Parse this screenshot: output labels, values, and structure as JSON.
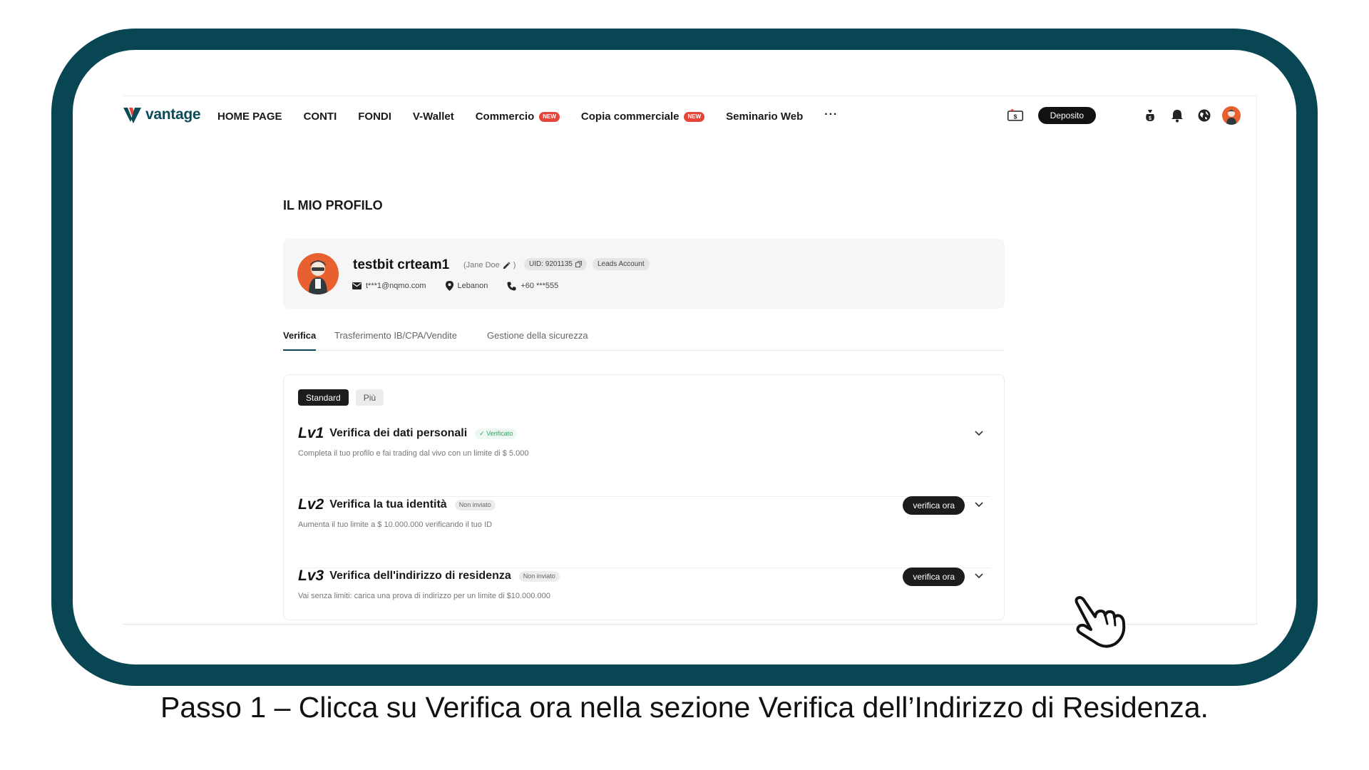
{
  "brand": {
    "name": "vantage"
  },
  "nav": {
    "links": [
      {
        "label": "HOME PAGE"
      },
      {
        "label": "CONTI"
      },
      {
        "label": "FONDI"
      },
      {
        "label": "V-Wallet"
      },
      {
        "label": "Commercio",
        "badge": "NEW"
      },
      {
        "label": "Copia commerciale",
        "badge": "NEW"
      },
      {
        "label": "Seminario Web"
      }
    ],
    "more": "···",
    "deposit_label": "Deposito"
  },
  "page": {
    "title": "IL MIO PROFILO"
  },
  "profile": {
    "name": "testbit crteam1",
    "alias": "(Jane Doe",
    "uid": "UID: 9201135",
    "account_type": "Leads Account",
    "email": "t***1@nqmo.com",
    "location": "Lebanon",
    "phone": "+60 ***555"
  },
  "tabs": [
    {
      "label": "Verifica",
      "active": true
    },
    {
      "label": "Trasferimento IB/CPA/Vendite",
      "active": false
    },
    {
      "label": "Gestione della sicurezza",
      "active": false
    }
  ],
  "verification": {
    "tiers": [
      "Standard",
      "Più"
    ],
    "levels": [
      {
        "tag": "Lv1",
        "title": "Verifica dei dati personali",
        "status": "✓ Verificato",
        "description": "Completa il tuo profilo e fai trading dal vivo con un limite di $ 5.000"
      },
      {
        "tag": "Lv2",
        "title": "Verifica la tua identità",
        "status": "Non inviato",
        "description": "Aumenta il tuo limite a $ 10.000.000 verificando il tuo ID",
        "action": "verifica ora"
      },
      {
        "tag": "Lv3",
        "title": "Verifica dell'indirizzo di residenza",
        "status": "Non inviato",
        "description": "Vai senza limiti: carica una prova di indirizzo per un limite di $10.000.000",
        "action": "verifica ora"
      }
    ]
  },
  "caption": "Passo 1 – Clicca su Verifica ora nella sezione Verifica dell’Indirizzo di Residenza.",
  "colors": {
    "frame": "#074652",
    "brand": "#0b4a57",
    "badge": "#e8453a",
    "chat": "#ef5a2c",
    "verified": "#2fa36b"
  }
}
